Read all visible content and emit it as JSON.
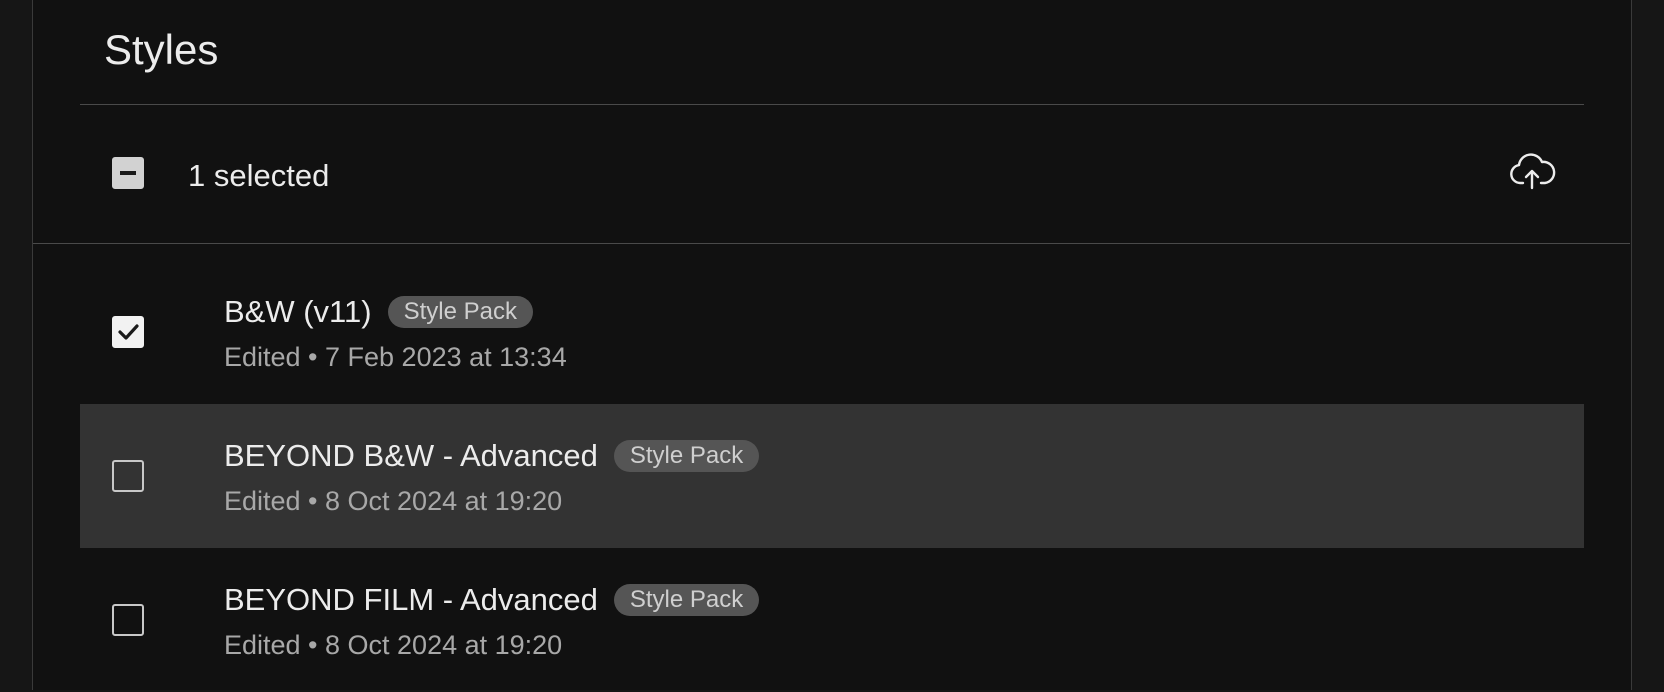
{
  "header": {
    "title": "Styles"
  },
  "toolbar": {
    "selection_label": "1 selected",
    "selection_state": "mixed",
    "upload_icon": "cloud-upload-icon"
  },
  "styles": [
    {
      "name": "B&W (v11)",
      "badge": "Style Pack",
      "edited": "Edited • 7 Feb 2023 at 13:34",
      "checked": true,
      "highlighted": false
    },
    {
      "name": "BEYOND B&W - Advanced",
      "badge": "Style Pack",
      "edited": "Edited • 8 Oct 2024 at 19:20",
      "checked": false,
      "highlighted": true
    },
    {
      "name": "BEYOND FILM - Advanced",
      "badge": "Style Pack",
      "edited": "Edited • 8 Oct 2024 at 19:20",
      "checked": false,
      "highlighted": false
    }
  ],
  "colors": {
    "background": "#111111",
    "row_highlight": "#333333",
    "badge_bg": "#555555"
  }
}
